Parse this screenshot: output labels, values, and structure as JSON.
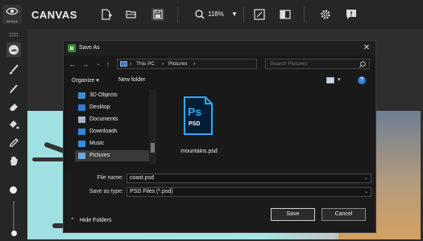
{
  "app": {
    "brand_text": "NVIDIA",
    "title": "CANVAS"
  },
  "toolbar": {
    "zoom_value": "118%"
  },
  "dialog": {
    "title": "Save As",
    "breadcrumb": [
      "This PC",
      "Pictures"
    ],
    "search_placeholder": "Search Pictures",
    "organize_label": "Organize ▾",
    "new_folder_label": "New folder",
    "nav_items": [
      {
        "label": "3D Objects",
        "icon": "3d-objects-icon",
        "color": "#3b8fd6"
      },
      {
        "label": "Desktop",
        "icon": "desktop-icon",
        "color": "#2d7dd2"
      },
      {
        "label": "Documents",
        "icon": "documents-icon",
        "color": "#9fb4cc"
      },
      {
        "label": "Downloads",
        "icon": "downloads-icon",
        "color": "#2f87e0"
      },
      {
        "label": "Music",
        "icon": "music-icon",
        "color": "#3a8ee0"
      },
      {
        "label": "Pictures",
        "icon": "pictures-icon",
        "color": "#6fa8dc",
        "selected": true
      }
    ],
    "files": [
      {
        "name": "mountains.psd",
        "icon_text": "Ps",
        "icon_subtext": "PSD",
        "icon_color": "#31a8ff"
      }
    ],
    "file_name_label": "File name:",
    "file_name_value": "coast.psd",
    "save_type_label": "Save as type:",
    "save_type_value": "PSD Files (*.psd)",
    "hide_folders_label": "Hide Folders",
    "save_button": "Save",
    "cancel_button": "Cancel"
  },
  "colors": {
    "accent": "#31a8ff",
    "dialog_bg": "#191919",
    "app_bg": "#262626"
  }
}
